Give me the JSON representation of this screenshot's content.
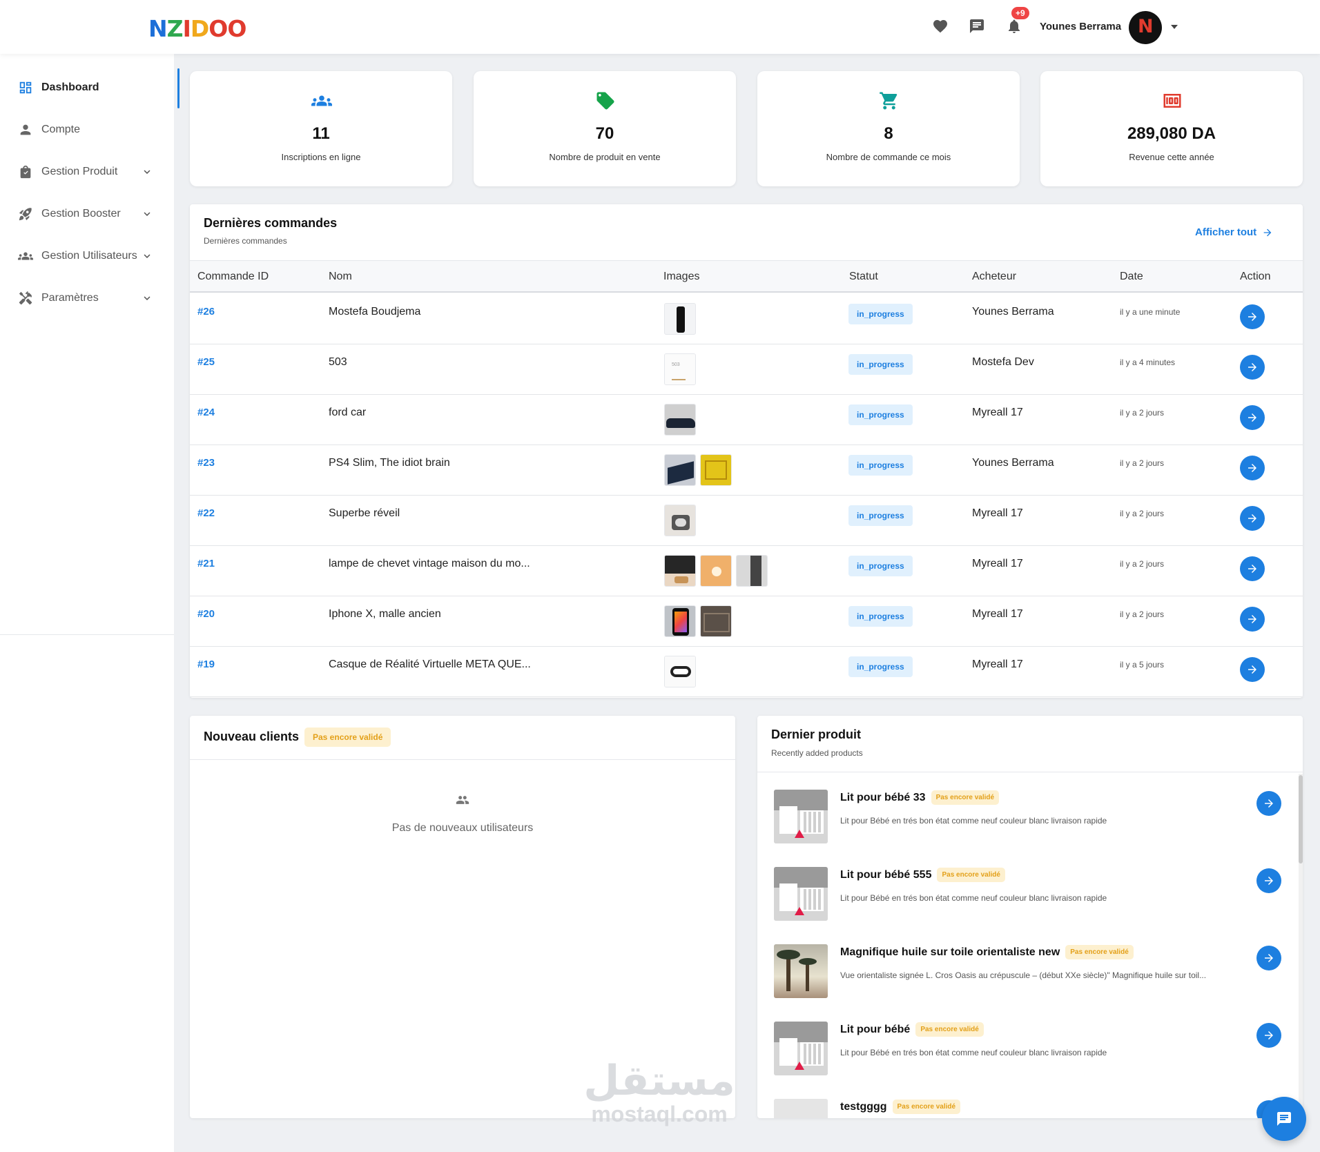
{
  "brand": {
    "logo_text": "NZIDOO"
  },
  "topbar": {
    "favorites_icon": "heart-icon",
    "messages_icon": "chat-bubble-icon",
    "notifications_icon": "bell-icon",
    "notifications_badge": "+9",
    "user_name": "Younes Berrama",
    "avatar_text": "N"
  },
  "sidebar": {
    "items": [
      {
        "label": "Dashboard",
        "icon": "dashboard-icon",
        "active": true
      },
      {
        "label": "Compte",
        "icon": "person-icon"
      },
      {
        "label": "Gestion Produit",
        "icon": "bag-icon",
        "expandable": true
      },
      {
        "label": "Gestion Booster",
        "icon": "rocket-icon",
        "expandable": true
      },
      {
        "label": "Gestion Utilisateurs",
        "icon": "users-icon",
        "expandable": true
      },
      {
        "label": "Paramètres",
        "icon": "tools-icon",
        "expandable": true
      }
    ]
  },
  "stats": [
    {
      "value": "11",
      "label": "Inscriptions en ligne",
      "icon": "users-icon",
      "color": "#1d7fe0"
    },
    {
      "value": "70",
      "label": "Nombre de produit en vente",
      "icon": "tag-icon",
      "color": "#16a34a"
    },
    {
      "value": "8",
      "label": "Nombre de commande ce mois",
      "icon": "cart-icon",
      "color": "#0f9f9a"
    },
    {
      "value": "289,080 DA",
      "label": "Revenue cette année",
      "icon": "money-icon",
      "color": "#e03b2e"
    }
  ],
  "orders": {
    "title": "Dernières commandes",
    "subtitle": "Dernières commandes",
    "view_all": "Afficher tout",
    "columns": [
      "Commande ID",
      "Nom",
      "Images",
      "Statut",
      "Acheteur",
      "Date",
      "Action"
    ],
    "rows": [
      {
        "id": "#26",
        "name": "Mostefa Boudjema",
        "status": "in_progress",
        "buyer": "Younes Berrama",
        "date": "il y a une minute",
        "images": [
          "phone"
        ]
      },
      {
        "id": "#25",
        "name": "503",
        "status": "in_progress",
        "buyer": "Mostefa Dev",
        "date": "il y a 4 minutes",
        "images": [
          "sketch"
        ]
      },
      {
        "id": "#24",
        "name": "ford car",
        "status": "in_progress",
        "buyer": "Myreall 17",
        "date": "il y a 2 jours",
        "images": [
          "car"
        ]
      },
      {
        "id": "#23",
        "name": "PS4 Slim, The idiot brain",
        "status": "in_progress",
        "buyer": "Younes Berrama",
        "date": "il y a 2 jours",
        "images": [
          "console",
          "book"
        ]
      },
      {
        "id": "#22",
        "name": "Superbe réveil",
        "status": "in_progress",
        "buyer": "Myreall 17",
        "date": "il y a 2 jours",
        "images": [
          "clock"
        ]
      },
      {
        "id": "#21",
        "name": "lampe de chevet vintage maison du mo...",
        "status": "in_progress",
        "buyer": "Myreall 17",
        "date": "il y a 2 jours",
        "images": [
          "lamp",
          "lamp-warm",
          "fabric"
        ]
      },
      {
        "id": "#20",
        "name": "Iphone X, malle ancien",
        "status": "in_progress",
        "buyer": "Myreall 17",
        "date": "il y a 2 jours",
        "images": [
          "iphone",
          "trunk"
        ]
      },
      {
        "id": "#19",
        "name": "Casque de Réalité Virtuelle META QUE...",
        "status": "in_progress",
        "buyer": "Myreall 17",
        "date": "il y a 5 jours",
        "images": [
          "vr"
        ]
      }
    ]
  },
  "new_clients": {
    "title": "Nouveau clients",
    "badge": "Pas encore validé",
    "empty_text": "Pas de nouveaux utilisateurs"
  },
  "latest_products": {
    "title": "Dernier produit",
    "subtitle": "Recently added products",
    "items": [
      {
        "name": "Lit pour bébé 33",
        "badge": "Pas encore validé",
        "desc": "Lit pour Bébé en trés bon état comme neuf couleur blanc livraison rapide",
        "image": "crib"
      },
      {
        "name": "Lit pour bébé 555",
        "badge": "Pas encore validé",
        "desc": "Lit pour Bébé en trés bon état comme neuf couleur blanc livraison rapide",
        "image": "crib"
      },
      {
        "name": "Magnifique huile sur toile orientaliste new",
        "badge": "Pas encore validé",
        "desc": "Vue orientaliste signée L. Cros Oasis au crépuscule – (début XXe siècle)\" Magnifique huile sur toil...",
        "image": "painting"
      },
      {
        "name": "Lit pour bébé",
        "badge": "Pas encore validé",
        "desc": "Lit pour Bébé en trés bon état comme neuf couleur blanc livraison rapide",
        "image": "crib"
      },
      {
        "name": "testgggg",
        "badge": "Pas encore validé",
        "desc": "",
        "image": "placeholder"
      }
    ]
  },
  "watermark": {
    "arabic": "مستقل",
    "latin": "mostaql.com"
  },
  "chat": {
    "icon": "chat-icon"
  }
}
